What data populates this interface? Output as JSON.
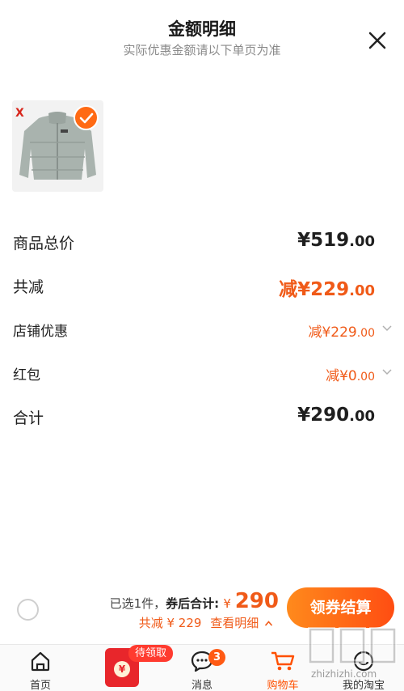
{
  "header": {
    "title": "金额明细",
    "subtitle": "实际优惠金额请以下单页为准"
  },
  "product": {
    "brand_logo_text": "X",
    "selected": true
  },
  "rows": [
    {
      "label": "商品总价",
      "prefix": "",
      "int": "¥519",
      "dec": ".00",
      "color": "#1f1f1f"
    },
    {
      "label": "共减",
      "prefix": "减",
      "int": "¥229",
      "dec": ".00",
      "color": "#f05a18"
    },
    {
      "label": "店铺优惠",
      "prefix": "减",
      "int": "¥229",
      "dec": ".00",
      "color": "#f05a18"
    },
    {
      "label": "红包",
      "prefix": "减",
      "int": "¥0",
      "dec": ".00",
      "color": "#f05a18"
    },
    {
      "label": "合计",
      "prefix": "",
      "int": "¥290",
      "dec": ".00",
      "color": "#1f1f1f"
    }
  ],
  "bottom": {
    "selected_text": "已选1件，",
    "after_coupon_label": "券后合计: ",
    "currency": "¥ ",
    "total": "290",
    "reduce_text": "共减 ¥ 229",
    "view_detail": "查看明细",
    "checkout_label": "领券结算"
  },
  "tabs": [
    {
      "label": "首页"
    },
    {
      "label": "消息",
      "badge": "3"
    },
    {
      "label": "购物车",
      "pill": "待领取"
    },
    {
      "label": "我的淘宝"
    }
  ],
  "watermark": {
    "text": "zhizhizhi.com"
  },
  "colors": {
    "accent": "#f05a18",
    "button_start": "#ff8a1c",
    "button_end": "#ff4d12"
  }
}
